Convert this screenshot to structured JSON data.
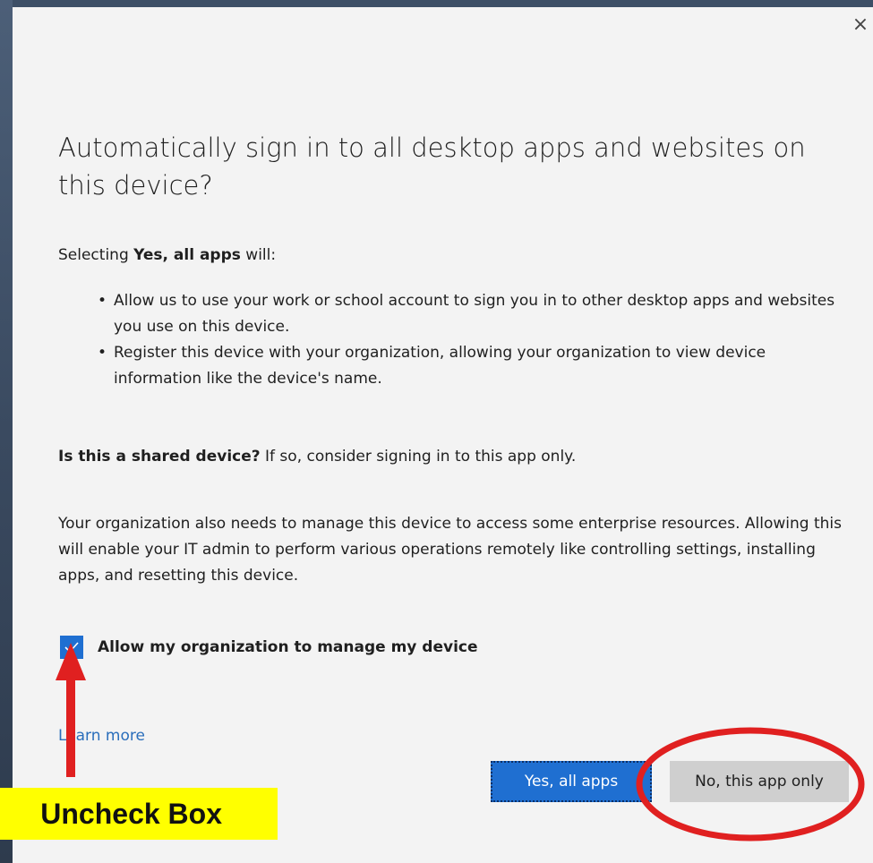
{
  "dialog": {
    "close_glyph": "×",
    "title": "Automatically sign in to all desktop apps and websites on this device?",
    "intro_prefix": "Selecting ",
    "intro_bold": "Yes, all apps",
    "intro_suffix": " will:",
    "bullets": [
      "Allow us to use your work or school account to sign you in to other desktop apps and websites you use on this device.",
      "Register this device with your organization, allowing your organization to view device information like the device's name."
    ],
    "shared_bold": "Is this a shared device?",
    "shared_rest": " If so, consider signing in to this app only.",
    "org_text": "Your organization also needs to manage this device to access some enterprise resources. Allowing this will enable your IT admin to perform various operations remotely like controlling settings, installing apps, and resetting this device.",
    "checkbox_label": "Allow my organization to manage my device",
    "checkbox_checked": true,
    "learn_more": "Learn more",
    "btn_yes": "Yes, all apps",
    "btn_no": "No, this app only"
  },
  "annotation": {
    "label": "Uncheck Box",
    "arrow_color": "#e02020",
    "circle_color": "#e02020",
    "label_bg": "#ffff00"
  },
  "colors": {
    "accent": "#1f6fd1",
    "link": "#2a6ebb",
    "dialog_bg": "#f3f3f3"
  }
}
